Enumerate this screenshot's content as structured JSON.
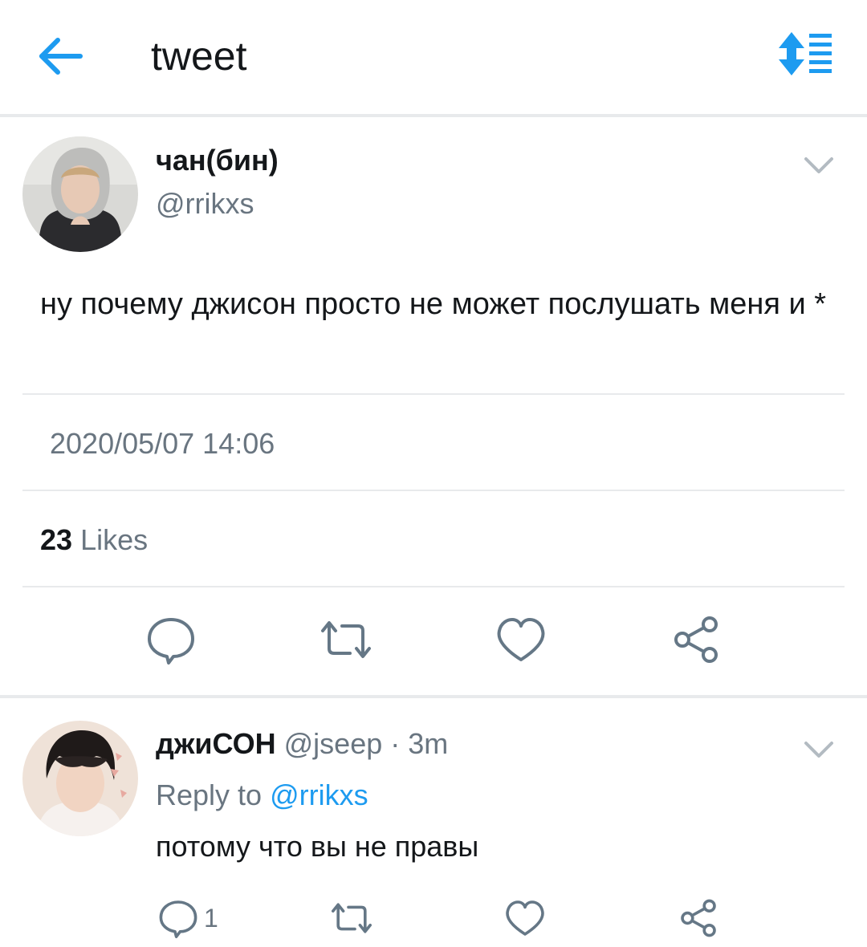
{
  "header": {
    "title": "tweet",
    "back_icon": "back-arrow-icon",
    "sort_icon": "sort-list-icon",
    "accent": "#1d9bf0"
  },
  "tweet": {
    "author_name": "чан(бин)",
    "author_handle": "@rrikxs",
    "text": "ну почему джисон просто не может послушать меня и *",
    "timestamp": "2020/05/07 14:06",
    "likes_count": "23",
    "likes_label": "Likes",
    "actions": [
      "reply-icon",
      "retweet-icon",
      "like-icon",
      "share-icon"
    ]
  },
  "reply": {
    "author_name": "джиСОН",
    "author_handle": "@jseep",
    "separator": "·",
    "age": "3m",
    "reply_to_label": "Reply to",
    "reply_to_handle": "@rrikxs",
    "text": "потому что вы не правы",
    "reply_count": "1",
    "actions": [
      "reply-icon",
      "retweet-icon",
      "like-icon",
      "share-icon"
    ]
  },
  "colors": {
    "text_primary": "#14171a",
    "text_secondary": "#697580",
    "divider": "#e8eaec",
    "icon_gray": "#657786"
  }
}
